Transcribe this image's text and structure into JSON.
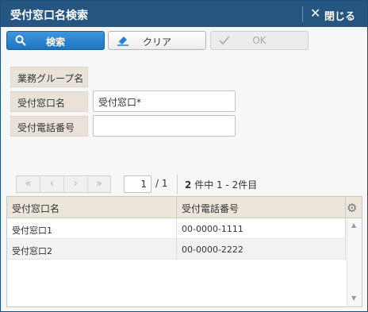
{
  "window": {
    "title": "受付窓口名検索",
    "close_label": "閉じる"
  },
  "toolbar": {
    "search_label": "検索",
    "clear_label": "クリア",
    "ok_label": "OK"
  },
  "form": {
    "group_label": "業務グループ名",
    "counter_name_label": "受付窓口名",
    "counter_name_value": "受付窓口*",
    "counter_phone_label": "受付電話番号",
    "counter_phone_value": ""
  },
  "pager": {
    "first": "«",
    "prev": "‹",
    "next": "›",
    "last": "»",
    "current_page": "1",
    "total_pages": "/ 1",
    "count_bold": "2",
    "count_rest": "件中 1 - 2件目"
  },
  "grid": {
    "columns": [
      "受付窓口名",
      "受付電話番号"
    ],
    "rows": [
      [
        "受付窓口1",
        "00-0000-1111"
      ],
      [
        "受付窓口2",
        "00-0000-2222"
      ]
    ]
  },
  "icons": {
    "close": "close-icon",
    "search": "search-icon",
    "clear": "eraser-icon",
    "ok": "check-icon",
    "settings": "gear-icon"
  },
  "colors": {
    "titlebar": "#245681",
    "primary_button": "#1f74bf",
    "label_bg": "#e8e2d8"
  }
}
